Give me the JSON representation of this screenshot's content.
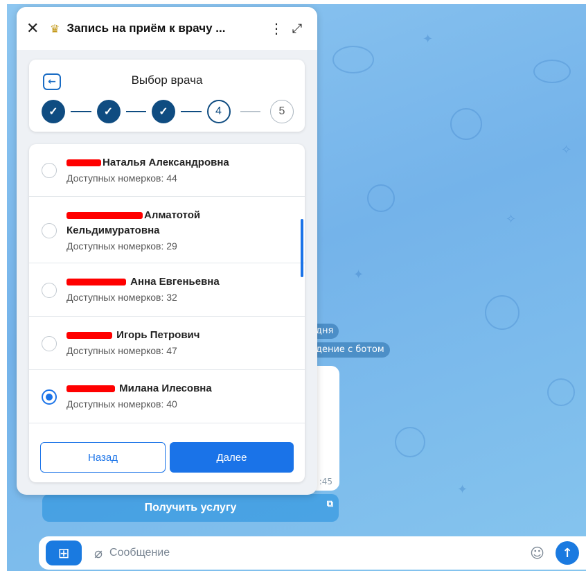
{
  "mini_app": {
    "title": "Запись на приём к врачу ...",
    "close_icon": "close-icon",
    "emblem_icon": "emblem-icon",
    "more_icon": "more-vertical-icon",
    "expand_icon": "expand-icon"
  },
  "steps": {
    "title": "Выбор врача",
    "back_icon": "arrow-left-icon",
    "items": [
      {
        "state": "done",
        "label": "✓"
      },
      {
        "state": "done",
        "label": "✓"
      },
      {
        "state": "done",
        "label": "✓"
      },
      {
        "state": "current",
        "label": "4"
      },
      {
        "state": "pending",
        "label": "5"
      }
    ]
  },
  "doctors": [
    {
      "name": "Наталья Александровна",
      "slots": "Доступных номерков: 44",
      "selected": false
    },
    {
      "name_line1": "Алматотой",
      "name_line2": "Кельдимуратовна",
      "slots": "Доступных номерков: 29",
      "selected": false
    },
    {
      "name": "Анна Евгеньевна",
      "slots": "Доступных номерков: 32",
      "selected": false
    },
    {
      "name": "Игорь Петрович",
      "slots": "Доступных номерков: 47",
      "selected": false
    },
    {
      "name": "Милана Илесовна",
      "slots": "Доступных номерков: 40",
      "selected": true
    }
  ],
  "buttons": {
    "back": "Назад",
    "next": "Далее"
  },
  "chat": {
    "pill_today": "дня",
    "pill_start": "дение с ботом",
    "bubble_time": ":45",
    "service_button": "Получить услугу",
    "service_icon": "external-link-icon",
    "input_placeholder": "Сообщение",
    "apps_icon": "apps-icon",
    "attach_icon": "paperclip-icon",
    "sticker_icon": "sticker-icon",
    "send_icon": "send-arrow-icon"
  },
  "colors": {
    "primary": "#1a73e8",
    "step_done": "#0f4c81",
    "redaction": "#ff0000",
    "chat_bg": "#7ab8ec"
  }
}
